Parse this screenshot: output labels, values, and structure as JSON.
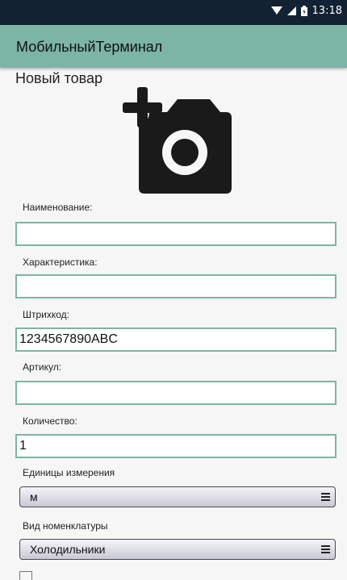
{
  "status_bar": {
    "time": "13:18",
    "icons": [
      "wifi-icon",
      "signal-icon",
      "battery-icon"
    ]
  },
  "app_bar": {
    "title": "МобильныйТерминал"
  },
  "page": {
    "title": "Новый товар"
  },
  "photo": {
    "icon": "add-photo-icon"
  },
  "form": {
    "name_label": "Наименование:",
    "name_value": "",
    "characteristic_label": "Характеристика:",
    "characteristic_value": "",
    "barcode_label": "Штрихкод:",
    "barcode_value": "1234567890ABC",
    "article_label": "Артикул:",
    "article_value": "",
    "quantity_label": "Количество:",
    "quantity_value": "1",
    "unit_label": "Единицы измерения",
    "unit_value": "м",
    "nomenclature_label": "Вид номенклатуры",
    "nomenclature_value": "Холодильники"
  },
  "colors": {
    "accent": "#7cb5a5",
    "status_bar": "#132232",
    "icon": "#1a1a1a"
  }
}
